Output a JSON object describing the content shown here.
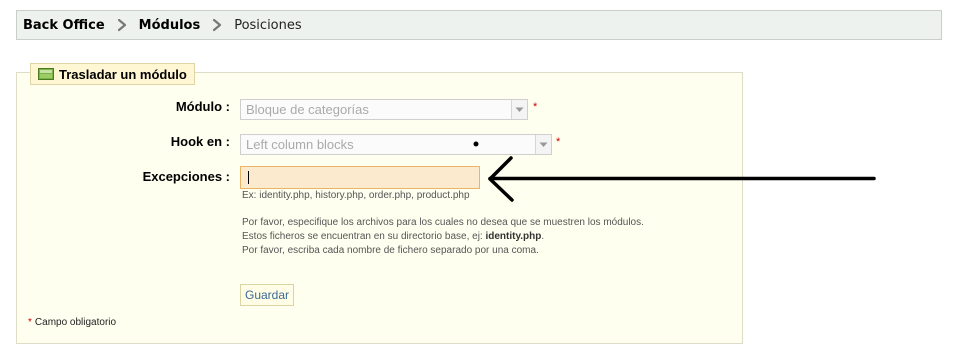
{
  "breadcrumb": {
    "items": [
      "Back Office",
      "Módulos",
      "Posiciones"
    ]
  },
  "panel": {
    "legend": "Trasladar un módulo",
    "legend_icon": "panel-icon"
  },
  "form": {
    "modulo": {
      "label": "Módulo :",
      "value": "Bloque de categorías",
      "required_mark": "*"
    },
    "hook": {
      "label": "Hook en :",
      "value": "Left column blocks",
      "required_mark": "*"
    },
    "excepciones": {
      "label": "Excepciones :",
      "value": "",
      "example": "Ex: identity.php, history.php, order.php, product.php"
    },
    "help": {
      "line1": "Por favor, especifique los archivos para los cuales no desea que se muestren los módulos.",
      "line2_prefix": "Estos ficheros se encuentran en su directorio base, ej: ",
      "line2_strong": "identity.php",
      "line2_suffix": ".",
      "line3": "Por favor, escriba cada nombre de fichero separado por una coma."
    },
    "save_label": "Guardar"
  },
  "footnote": {
    "star": "*",
    "text": "Campo obligatorio"
  },
  "colors": {
    "breadcrumb_bg": "#eef2ee",
    "panel_bg": "#fffff0",
    "input_focus_bg": "#fbeacd",
    "required": "#cc0000",
    "button_text": "#3a6a96"
  }
}
